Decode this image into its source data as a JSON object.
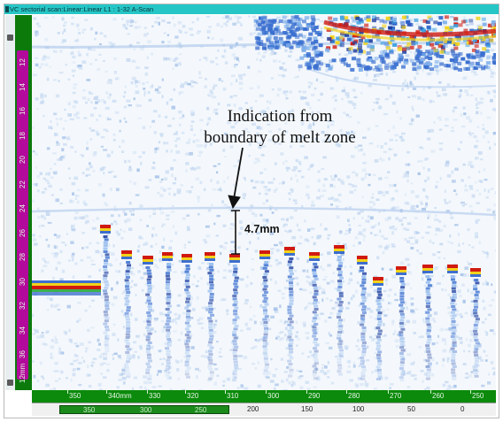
{
  "window": {
    "title": "VC sectorial scan:Linear:Linear  L1 : 1-32 A-Scan",
    "icons": [
      "app-icon"
    ]
  },
  "annotation": {
    "line1": "Indication from",
    "line2": "boundary of melt zone",
    "measurement": "4.7mm"
  },
  "vertical_ruler": {
    "ticks": [
      "12",
      "14",
      "16",
      "18",
      "20",
      "22",
      "24",
      "26",
      "28",
      "30",
      "32",
      "34",
      "36",
      "12mm"
    ]
  },
  "horizontal_ruler": {
    "ticks": [
      "350",
      "340mm",
      "330",
      "320",
      "310",
      "300",
      "290",
      "280",
      "270",
      "260",
      "250"
    ]
  },
  "bottom_bar": {
    "ticks": [
      "350",
      "300",
      "250",
      "200",
      "150",
      "100",
      "50",
      "0"
    ]
  },
  "colors": {
    "titlebar": "#26c6c6",
    "ruler_green": "#0b8a0b",
    "ruler_magenta": "#b20a9a",
    "scan_blue": "#2a5fc8",
    "scan_red": "#d01a10",
    "scan_yellow": "#f2d21a"
  }
}
